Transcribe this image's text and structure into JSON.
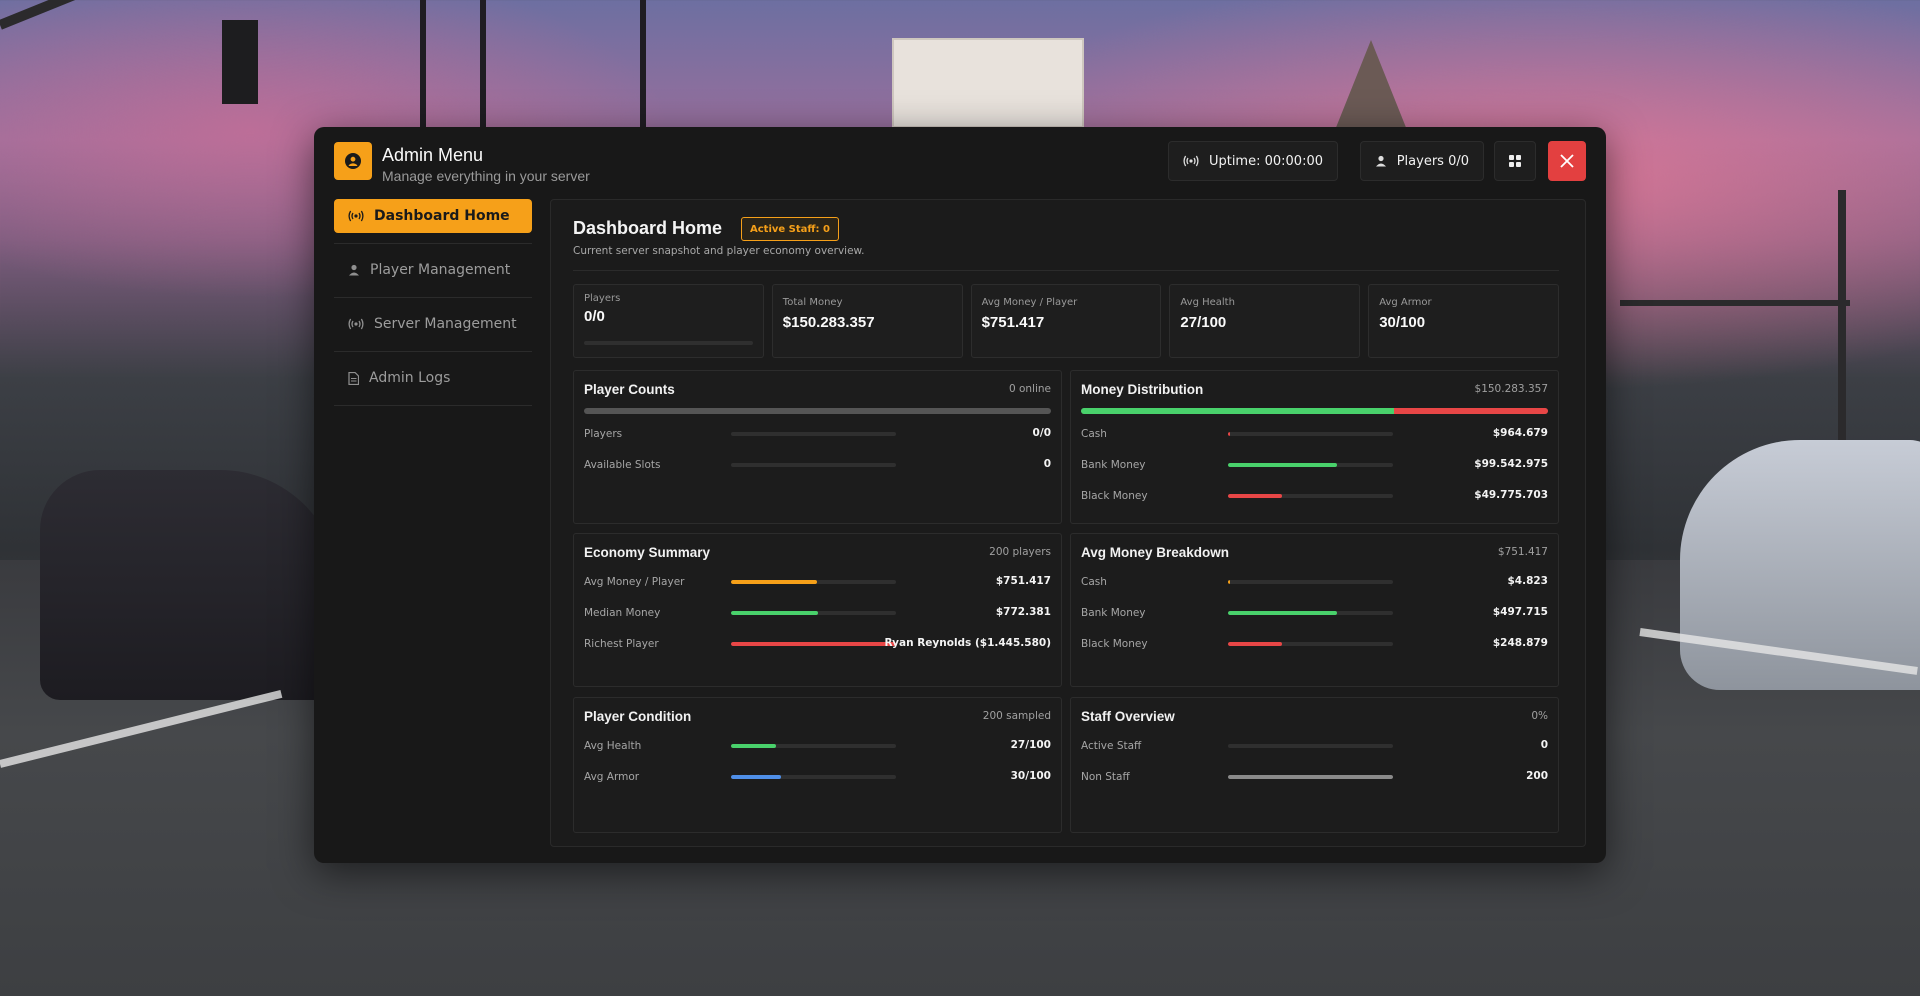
{
  "header": {
    "title": "Admin Menu",
    "subtitle": "Manage everything in your server",
    "uptime": "Uptime: 00:00:00",
    "players": "Players 0/0"
  },
  "sidebar": {
    "items": [
      {
        "label": "Dashboard Home",
        "icon": "broadcast-icon",
        "active": true
      },
      {
        "label": "Player Management",
        "icon": "user-icon",
        "active": false
      },
      {
        "label": "Server Management",
        "icon": "broadcast-icon",
        "active": false
      },
      {
        "label": "Admin Logs",
        "icon": "document-icon",
        "active": false
      }
    ]
  },
  "main": {
    "title": "Dashboard Home",
    "badge": "Active Staff: 0",
    "description": "Current server snapshot and player economy overview."
  },
  "stats": [
    {
      "label": "Players",
      "value": "0/0",
      "progress": 0
    },
    {
      "label": "Total Money",
      "value": "$150.283.357"
    },
    {
      "label": "Avg Money / Player",
      "value": "$751.417"
    },
    {
      "label": "Avg Health",
      "value": "27/100"
    },
    {
      "label": "Avg Armor",
      "value": "30/100"
    }
  ],
  "cards": {
    "player_counts": {
      "title": "Player Counts",
      "meta": "0 online",
      "overall_fill": 0,
      "rows": [
        {
          "label": "Players",
          "value": "0/0",
          "fill": 0
        },
        {
          "label": "Available Slots",
          "value": "0",
          "fill": 0
        }
      ]
    },
    "money_distribution": {
      "title": "Money Distribution",
      "meta": "$150.283.357",
      "split": [
        0.67,
        0.33
      ],
      "rows": [
        {
          "label": "Cash",
          "value": "$964.679",
          "fill": 0.006,
          "color": "#e84646"
        },
        {
          "label": "Bank Money",
          "value": "$99.542.975",
          "fill": 0.66,
          "color": "#49d16b"
        },
        {
          "label": "Black Money",
          "value": "$49.775.703",
          "fill": 0.33,
          "color": "#e84646"
        }
      ]
    },
    "economy_summary": {
      "title": "Economy Summary",
      "meta": "200 players",
      "rows": [
        {
          "label": "Avg Money / Player",
          "value": "$751.417",
          "fill": 0.52,
          "color": "#f6a019"
        },
        {
          "label": "Median Money",
          "value": "$772.381",
          "fill": 0.53,
          "color": "#49d16b"
        },
        {
          "label": "Richest Player",
          "value": "Ryan Reynolds ($1.445.580)",
          "fill": 1.0,
          "color": "#e84646"
        }
      ]
    },
    "avg_money_breakdown": {
      "title": "Avg Money Breakdown",
      "meta": "$751.417",
      "rows": [
        {
          "label": "Cash",
          "value": "$4.823",
          "fill": 0.006,
          "color": "#f6a019"
        },
        {
          "label": "Bank Money",
          "value": "$497.715",
          "fill": 0.66,
          "color": "#49d16b"
        },
        {
          "label": "Black Money",
          "value": "$248.879",
          "fill": 0.33,
          "color": "#e84646"
        }
      ]
    },
    "player_condition": {
      "title": "Player Condition",
      "meta": "200 sampled",
      "rows": [
        {
          "label": "Avg Health",
          "value": "27/100",
          "fill": 0.27,
          "color": "#49d16b"
        },
        {
          "label": "Avg Armor",
          "value": "30/100",
          "fill": 0.3,
          "color": "#4f8fe8"
        }
      ]
    },
    "staff_overview": {
      "title": "Staff Overview",
      "meta": "0%",
      "rows": [
        {
          "label": "Active Staff",
          "value": "0",
          "fill": 0,
          "color": "#8a8a8a"
        },
        {
          "label": "Non Staff",
          "value": "200",
          "fill": 1.0,
          "color": "#8a8a8a"
        }
      ]
    }
  },
  "colors": {
    "accent": "#f6a019",
    "close": "#e34040",
    "green": "#49d16b",
    "red": "#e84646",
    "blue": "#4f8fe8"
  }
}
